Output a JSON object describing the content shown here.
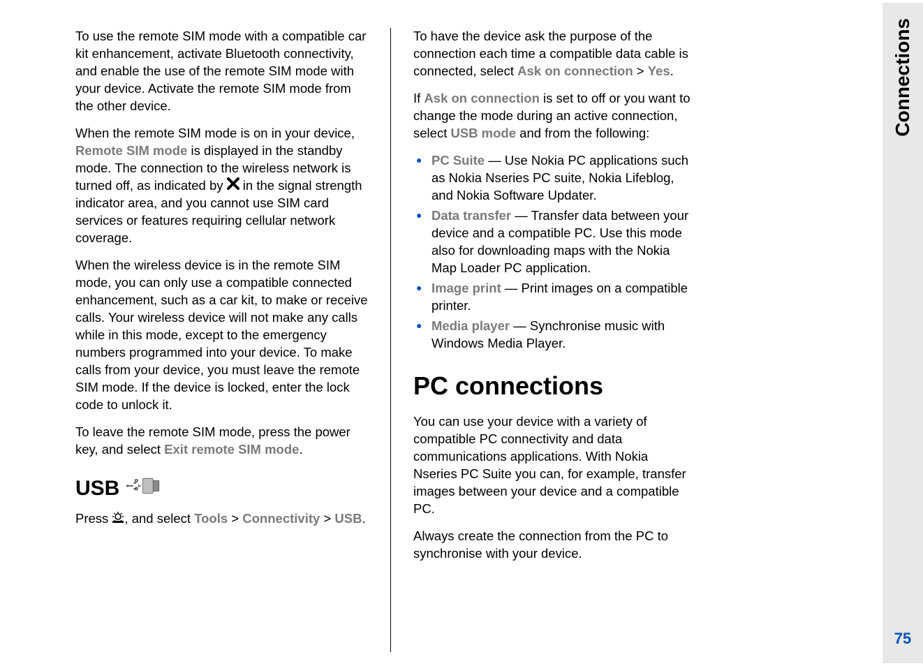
{
  "sideTab": {
    "label": "Connections",
    "pageNumber": "75"
  },
  "left": {
    "p1": "To use the remote SIM mode with a compatible car kit enhancement, activate Bluetooth connectivity, and enable the use of the remote SIM mode with your device. Activate the remote SIM mode from the other device.",
    "p2a": "When the remote SIM mode is on in your device, ",
    "p2b_label": "Remote SIM mode",
    "p2c": " is displayed in the standby mode. The connection to the wireless network is turned off, as indicated by ",
    "p2d": " in the signal strength indicator area, and you cannot use SIM card services or features requiring cellular network coverage.",
    "p3": "When the wireless device is in the remote SIM mode, you can only use a compatible connected enhancement, such as a car kit, to make or receive calls. Your wireless device will not make any calls while in this mode, except to the emergency numbers programmed into your device. To make calls from your device, you must leave the remote SIM mode. If the device is locked, enter the lock code to unlock it.",
    "p4a": "To leave the remote SIM mode, press the power key, and select ",
    "p4b_label": "Exit remote SIM mode",
    "p4c": ".",
    "usb_heading": "USB",
    "p5a": "Press ",
    "p5b": ", and select ",
    "p5c_label1": "Tools",
    "p5d": " > ",
    "p5e_label2": "Connectivity",
    "p5f": " > ",
    "p5g_label3": "USB",
    "p5h": "."
  },
  "right": {
    "p1a": "To have the device ask the purpose of the connection each time a compatible data cable is connected, select ",
    "p1b_label1": "Ask on connection",
    "p1c": " > ",
    "p1d_label2": "Yes",
    "p1e": ".",
    "p2a": "If ",
    "p2b_label1": "Ask on connection",
    "p2c": " is set to off or you want to change the mode during an active connection, select ",
    "p2d_label2": "USB mode",
    "p2e": " and from the following:",
    "bullets": [
      {
        "label": "PC Suite",
        "text": "  — Use Nokia PC applications such as Nokia Nseries PC suite, Nokia Lifeblog, and Nokia Software Updater."
      },
      {
        "label": "Data transfer",
        "text": "  — Transfer data between your device and a compatible PC. Use this mode also for downloading maps with the Nokia Map Loader PC application."
      },
      {
        "label": "Image print",
        "text": "  — Print images on a compatible printer."
      },
      {
        "label": "Media player",
        "text": "  — Synchronise music with Windows Media Player."
      }
    ],
    "h1": "PC connections",
    "p3": "You can use your device with a variety of compatible PC connectivity and data communications applications. With Nokia Nseries PC Suite you can, for example, transfer images between your device and a compatible PC.",
    "p4": "Always create the connection from the PC to synchronise with your device."
  }
}
